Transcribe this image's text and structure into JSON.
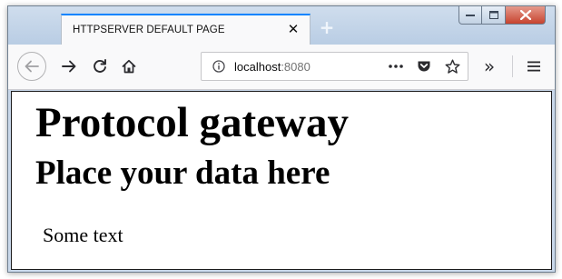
{
  "tab": {
    "title": "HTTPSERVER DEFAULT PAGE",
    "close_glyph": "✕",
    "new_tab_glyph": "+"
  },
  "toolbar": {
    "back_icon": "back-arrow-icon",
    "forward_icon": "forward-arrow-icon",
    "reload_icon": "reload-icon",
    "home_icon": "home-icon",
    "overflow_glyph": "»",
    "menu_icon": "hamburger-menu-icon"
  },
  "urlbar": {
    "host": "localhost",
    "port": ":8080",
    "info_icon": "info-icon",
    "page_actions_glyph": "•••",
    "pocket_icon": "pocket-icon",
    "bookmark_icon": "star-icon"
  },
  "page": {
    "heading1": "Protocol gateway",
    "heading2": "Place your data here",
    "paragraph": "Some text"
  },
  "colors": {
    "tab_accent": "#0a84ff",
    "close_button": "#c7432f",
    "chrome_background": "#c9d8ea"
  }
}
